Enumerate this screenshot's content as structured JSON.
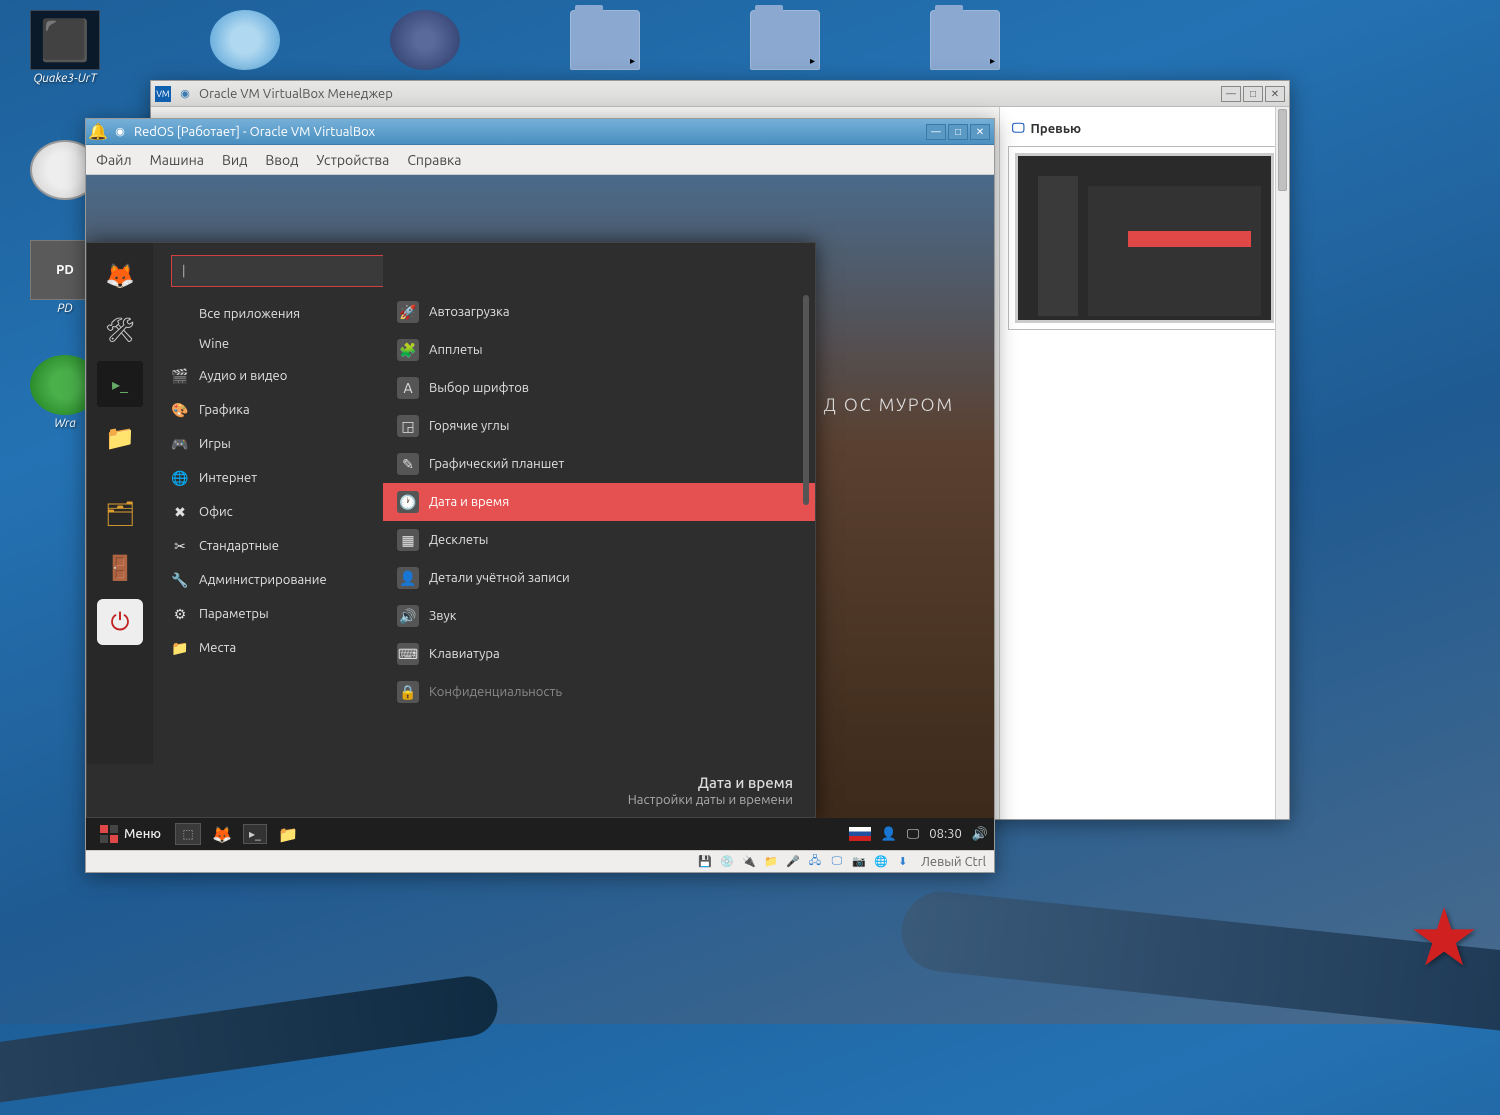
{
  "host": {
    "desktop_icons": [
      {
        "id": "quake",
        "label": "Quake3-UrT"
      },
      {
        "id": "chromium",
        "label": ""
      },
      {
        "id": "seamonkey",
        "label": ""
      },
      {
        "id": "folder1",
        "label": ""
      },
      {
        "id": "folder2",
        "label": ""
      },
      {
        "id": "folder3",
        "label": ""
      }
    ],
    "side_icons": [
      {
        "id": "clock",
        "label": ""
      },
      {
        "id": "pd",
        "label": "PD"
      },
      {
        "id": "wraith",
        "label": "Wra"
      }
    ]
  },
  "manager_window": {
    "title": "Oracle VM VirtualBox Менеджер",
    "preview_label": "Превью"
  },
  "vm_window": {
    "title": "RedOS [Работает] - Oracle VM VirtualBox",
    "menubar": [
      "Файл",
      "Машина",
      "Вид",
      "Ввод",
      "Устройства",
      "Справка"
    ],
    "statusbar_text": "Левый Ctrl",
    "watermark": "Д ОС МУРОМ"
  },
  "cinnamon": {
    "panel": {
      "menu_label": "Меню",
      "time": "08:30"
    },
    "menu": {
      "search_placeholder": "",
      "categories": [
        {
          "icon": "",
          "label": "Все приложения",
          "no_icon": true
        },
        {
          "icon": "",
          "label": "Wine",
          "no_icon": true
        },
        {
          "icon": "🎬",
          "label": "Аудио и видео"
        },
        {
          "icon": "🎨",
          "label": "Графика"
        },
        {
          "icon": "🎮",
          "label": "Игры"
        },
        {
          "icon": "🌐",
          "label": "Интернет"
        },
        {
          "icon": "✖",
          "label": "Офис"
        },
        {
          "icon": "✂",
          "label": "Стандартные"
        },
        {
          "icon": "🔧",
          "label": "Администрирование"
        },
        {
          "icon": "⚙",
          "label": "Параметры"
        },
        {
          "icon": "📁",
          "label": "Места"
        }
      ],
      "apps": [
        {
          "icon": "🚀",
          "label": "Автозагрузка"
        },
        {
          "icon": "🧩",
          "label": "Апплеты"
        },
        {
          "icon": "A",
          "label": "Выбор шрифтов"
        },
        {
          "icon": "◲",
          "label": "Горячие углы"
        },
        {
          "icon": "✎",
          "label": "Графический планшет"
        },
        {
          "icon": "🕐",
          "label": "Дата и время",
          "selected": true
        },
        {
          "icon": "▦",
          "label": "Десклеты"
        },
        {
          "icon": "👤",
          "label": "Детали учётной записи"
        },
        {
          "icon": "🔊",
          "label": "Звук"
        },
        {
          "icon": "⌨",
          "label": "Клавиатура"
        },
        {
          "icon": "🔒",
          "label": "Конфиденциальность",
          "dim": true
        }
      ],
      "footer_title": "Дата и время",
      "footer_sub": "Настройки даты и времени"
    }
  }
}
